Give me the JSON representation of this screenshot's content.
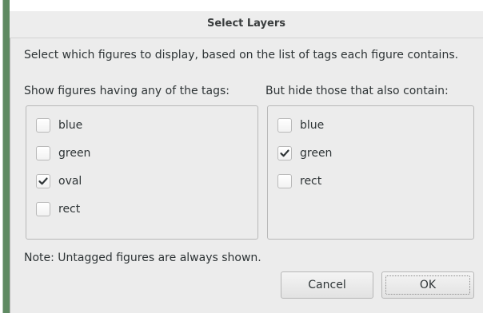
{
  "dialog": {
    "title": "Select Layers",
    "description": "Select which figures to display, based on the list of tags each figure contains.",
    "show_label": "Show figures having any of the tags:",
    "hide_label": "But hide those that also contain:",
    "show_tags": [
      {
        "label": "blue",
        "checked": false
      },
      {
        "label": "green",
        "checked": false
      },
      {
        "label": "oval",
        "checked": true
      },
      {
        "label": "rect",
        "checked": false
      }
    ],
    "hide_tags": [
      {
        "label": "blue",
        "checked": false
      },
      {
        "label": "green",
        "checked": true
      },
      {
        "label": "rect",
        "checked": false
      }
    ],
    "note": "Note: Untagged figures are always shown.",
    "cancel_label": "Cancel",
    "ok_label": "OK"
  }
}
